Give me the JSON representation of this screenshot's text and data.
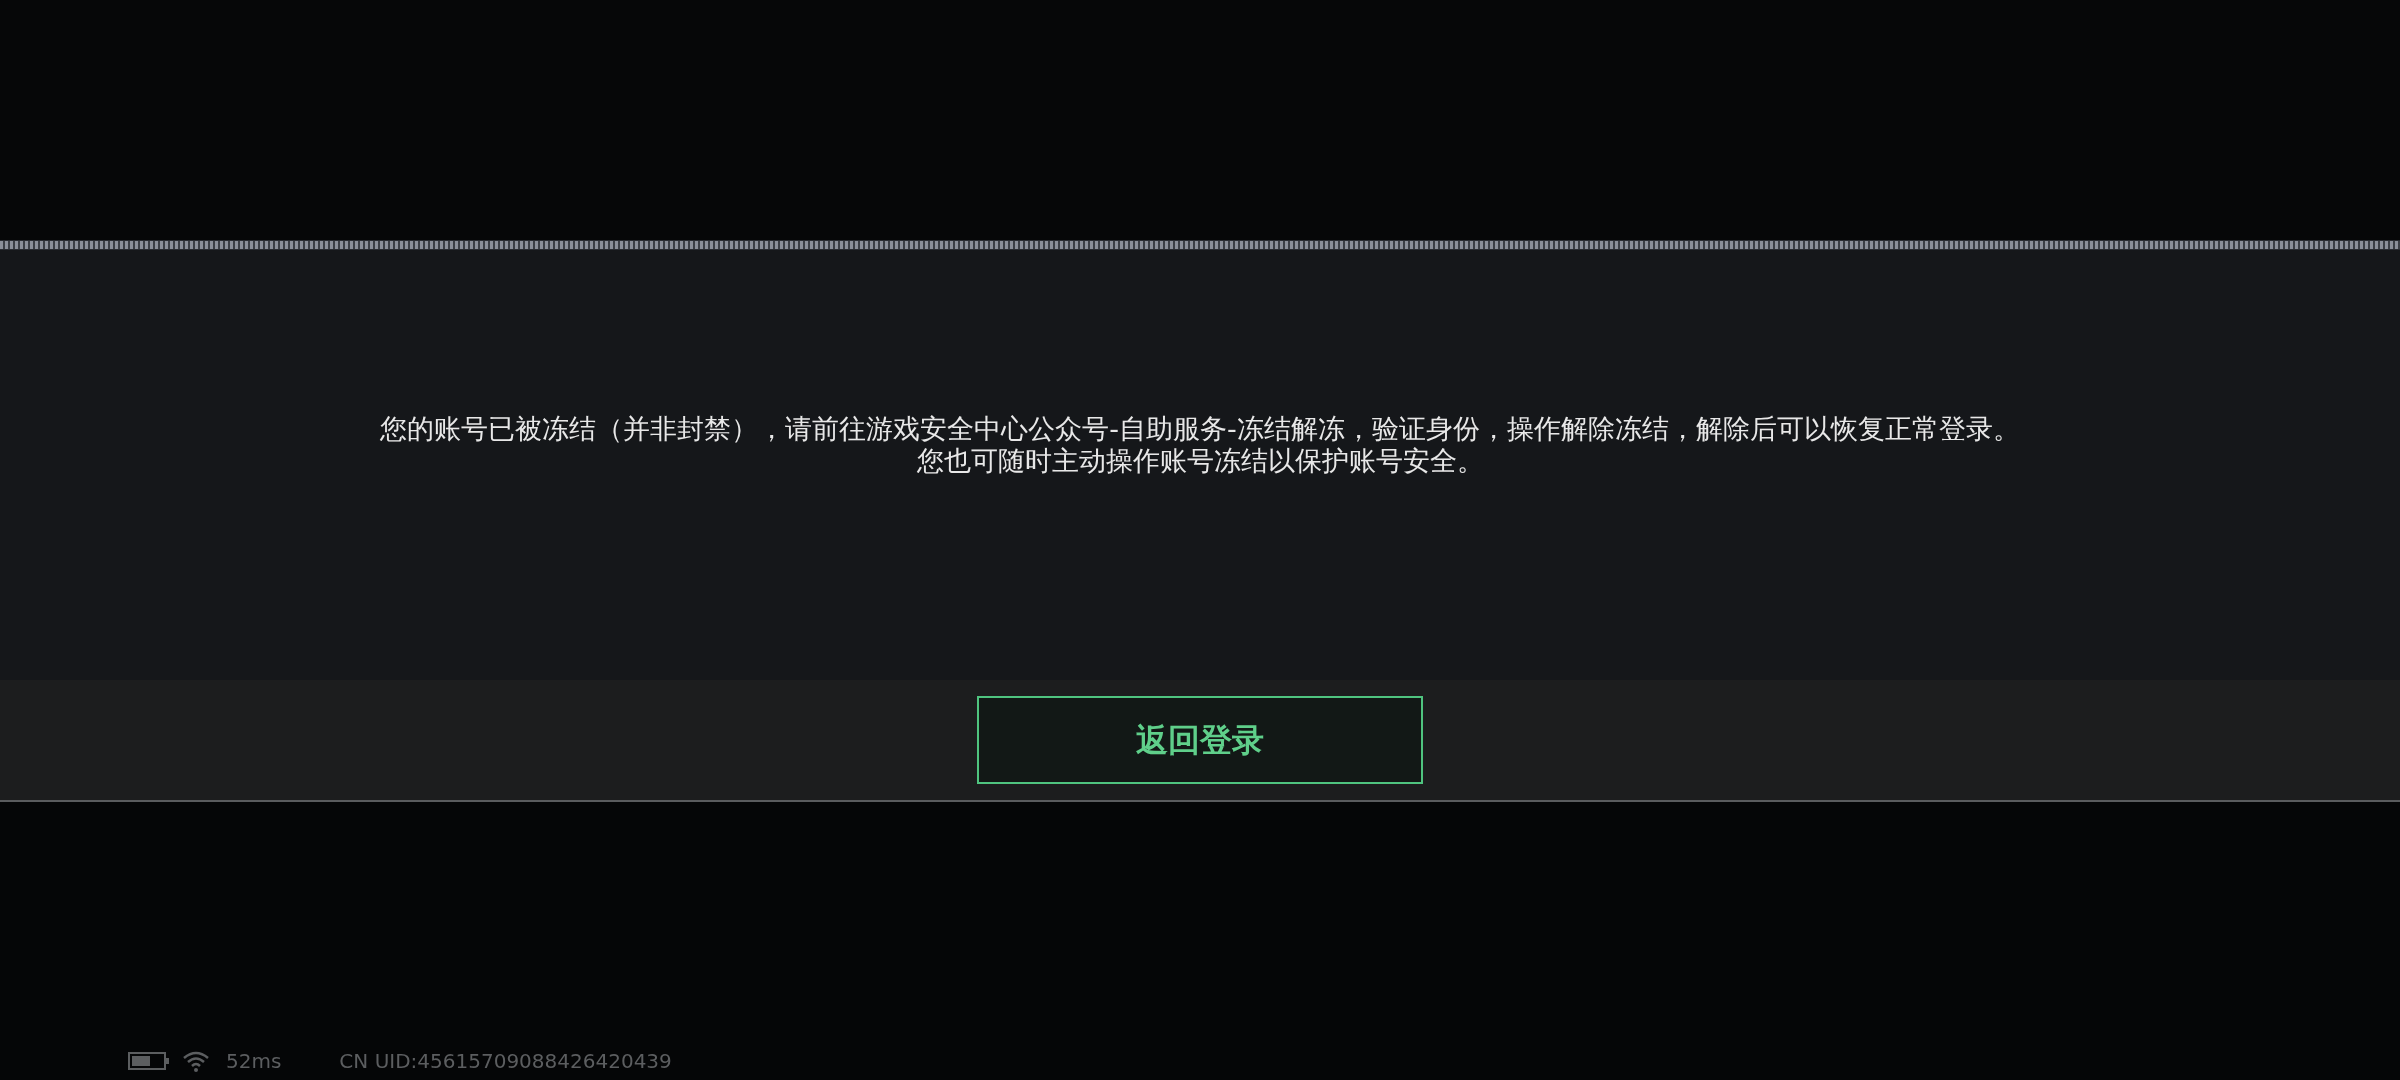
{
  "dialog": {
    "message_lines": [
      "您的账号已被冻结（并非封禁），请前往游戏安全中心公众号-自助服务-冻结解冻，验证身份，操作解除冻结，解除后可以恢复正常登录。",
      "您也可随时主动操作账号冻结以保护账号安全。"
    ],
    "button": "返回登录"
  },
  "status_bar": {
    "ping": "52ms",
    "uid": "CN UID:45615709088426420439"
  }
}
